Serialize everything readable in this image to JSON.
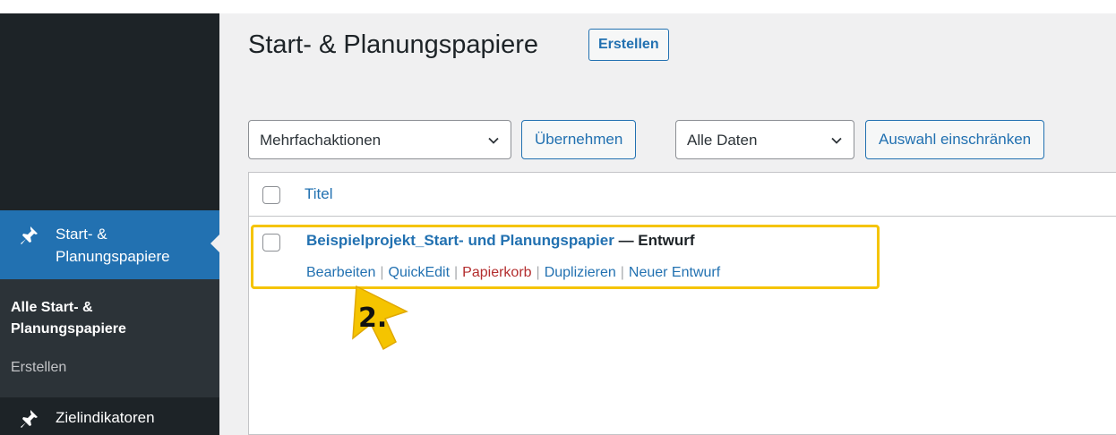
{
  "sidebar": {
    "active_menu": {
      "label": "Start- & Planungspapiere",
      "icon": "pin-icon"
    },
    "submenu": {
      "current": "Alle Start- & Planungspapiere",
      "add_new": "Erstellen"
    },
    "next_menu": {
      "label": "Zielindikatoren",
      "icon": "pin-icon"
    }
  },
  "header": {
    "title": "Start- & Planungspapiere",
    "add_new_label": "Erstellen"
  },
  "toolbar": {
    "bulk_actions": "Mehrfachaktionen",
    "apply_label": "Übernehmen",
    "dates_filter": "Alle Daten",
    "filter_label": "Auswahl einschränken"
  },
  "table": {
    "column_title": "Titel",
    "rows": [
      {
        "title": "Beispielprojekt_Start- und Planungspapier",
        "state": " — Entwurf",
        "actions": {
          "edit": "Bearbeiten",
          "quick_edit": "QuickEdit",
          "trash": "Papierkorb",
          "duplicate": "Duplizieren",
          "new_draft": "Neuer Entwurf"
        }
      }
    ]
  },
  "annotation": {
    "step": "2.",
    "highlight_color": "#f5c400"
  },
  "colors": {
    "accent": "#2271b1",
    "trash": "#b32d2e",
    "sidebar": "#1d2327"
  }
}
